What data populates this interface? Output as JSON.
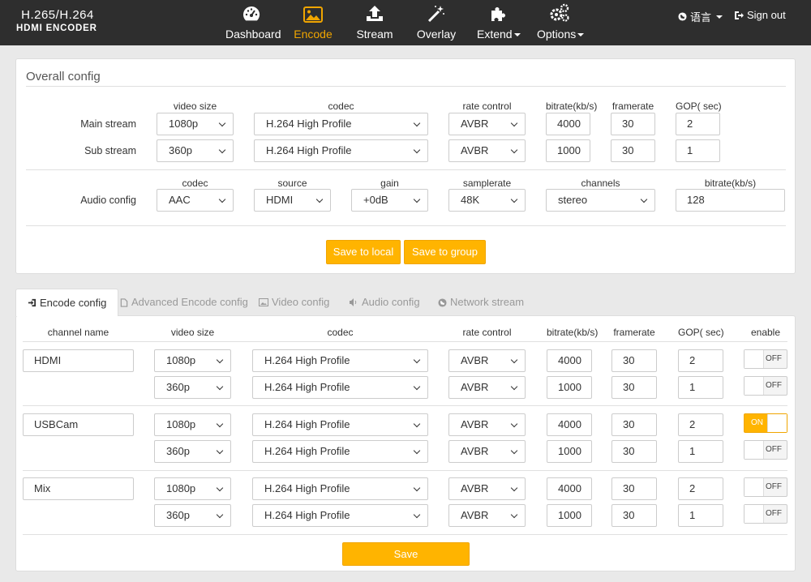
{
  "brand": {
    "line1": "H.265/H.264",
    "line2": "HDMI ENCODER"
  },
  "nav": [
    {
      "label": "Dashboard",
      "icon": "dashboard-icon"
    },
    {
      "label": "Encode",
      "icon": "image-icon",
      "active": true
    },
    {
      "label": "Stream",
      "icon": "upload-icon"
    },
    {
      "label": "Overlay",
      "icon": "magic-wand-icon"
    },
    {
      "label": "Extend",
      "icon": "puzzle-icon"
    },
    {
      "label": "Options",
      "icon": "gears-icon"
    }
  ],
  "lang": "语言",
  "signout": "Sign out",
  "overall": {
    "title": "Overall config",
    "video_headers": [
      "video size",
      "codec",
      "rate control",
      "bitrate(kb/s)",
      "framerate",
      "GOP( sec)"
    ],
    "main": {
      "label": "Main stream",
      "size": "1080p",
      "codec": "H.264 High Profile",
      "rate": "AVBR",
      "bitrate": "4000",
      "framerate": "30",
      "gop": "2"
    },
    "sub": {
      "label": "Sub stream",
      "size": "360p",
      "codec": "H.264 High Profile",
      "rate": "AVBR",
      "bitrate": "1000",
      "framerate": "30",
      "gop": "1"
    },
    "audio_headers": [
      "codec",
      "source",
      "gain",
      "samplerate",
      "channels",
      "bitrate(kb/s)"
    ],
    "audio": {
      "label": "Audio config",
      "codec": "AAC",
      "source": "HDMI",
      "gain": "+0dB",
      "samplerate": "48K",
      "channels": "stereo",
      "bitrate": "128"
    },
    "save_local": "Save to local",
    "save_group": "Save to group"
  },
  "tabs": [
    {
      "label": "Encode config",
      "icon": "sign-in-icon",
      "active": true
    },
    {
      "label": "Advanced Encode config",
      "icon": "file-icon"
    },
    {
      "label": "Video config",
      "icon": "picture-icon"
    },
    {
      "label": "Audio config",
      "icon": "volume-icon"
    },
    {
      "label": "Network stream",
      "icon": "globe-icon"
    }
  ],
  "encode": {
    "headers": [
      "channel name",
      "video size",
      "codec",
      "rate control",
      "bitrate(kb/s)",
      "framerate",
      "GOP( sec)",
      "enable"
    ],
    "channels": [
      {
        "name": "HDMI",
        "rows": [
          {
            "size": "1080p",
            "codec": "H.264 High Profile",
            "rate": "AVBR",
            "bitrate": "4000",
            "framerate": "30",
            "gop": "2",
            "enable": "OFF"
          },
          {
            "size": "360p",
            "codec": "H.264 High Profile",
            "rate": "AVBR",
            "bitrate": "1000",
            "framerate": "30",
            "gop": "1",
            "enable": "OFF"
          }
        ]
      },
      {
        "name": "USBCam",
        "rows": [
          {
            "size": "1080p",
            "codec": "H.264 High Profile",
            "rate": "AVBR",
            "bitrate": "4000",
            "framerate": "30",
            "gop": "2",
            "enable": "ON"
          },
          {
            "size": "360p",
            "codec": "H.264 High Profile",
            "rate": "AVBR",
            "bitrate": "1000",
            "framerate": "30",
            "gop": "1",
            "enable": "OFF"
          }
        ]
      },
      {
        "name": "Mix",
        "rows": [
          {
            "size": "1080p",
            "codec": "H.264 High Profile",
            "rate": "AVBR",
            "bitrate": "4000",
            "framerate": "30",
            "gop": "2",
            "enable": "OFF"
          },
          {
            "size": "360p",
            "codec": "H.264 High Profile",
            "rate": "AVBR",
            "bitrate": "1000",
            "framerate": "30",
            "gop": "1",
            "enable": "OFF"
          }
        ]
      }
    ],
    "save": "Save"
  },
  "colors": {
    "accent": "#ffb400",
    "navbar": "#2e2e2e",
    "active_nav": "#f0a500"
  }
}
